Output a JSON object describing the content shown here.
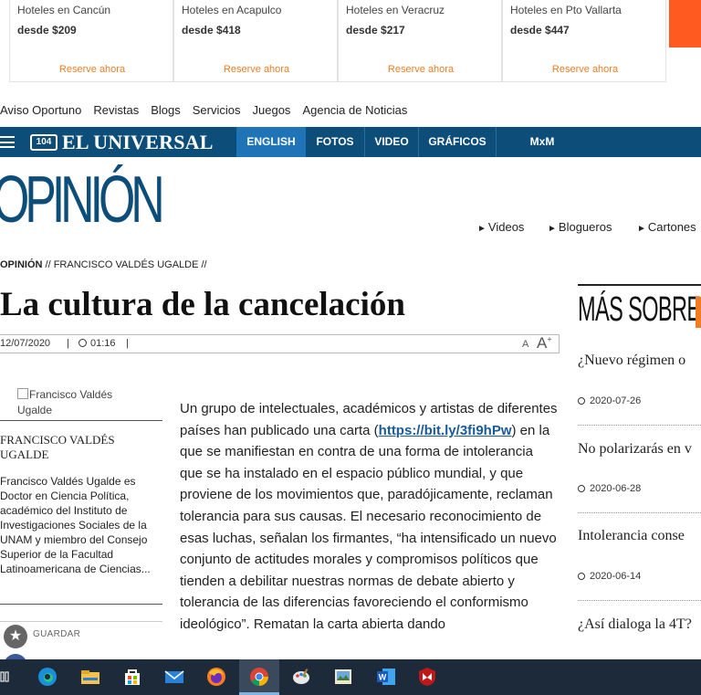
{
  "hotels": [
    {
      "name": "Hoteles en Cancún",
      "price": "desde $209",
      "cta": "Reserve ahora"
    },
    {
      "name": "Hoteles en Acapulco",
      "price": "desde $418",
      "cta": "Reserve ahora"
    },
    {
      "name": "Hoteles en Veracruz",
      "price": "desde $217",
      "cta": "Reserve ahora"
    },
    {
      "name": "Hoteles en Pto Vallarta",
      "price": "desde $447",
      "cta": "Reserve ahora"
    }
  ],
  "topnav": [
    "Aviso Oportuno",
    "Revistas",
    "Blogs",
    "Servicios",
    "Juegos",
    "Agencia de Noticias"
  ],
  "header": {
    "logo_glyph": "104",
    "logo": "EL UNIVERSAL",
    "items": [
      "ENGLISH",
      "FOTOS",
      "VIDEO",
      "GRÁFICOS",
      "MxM"
    ],
    "accent": "#0c4d7a",
    "active_color": "#1f74b7"
  },
  "section": {
    "title": "OPINIÓN",
    "links": [
      "Videos",
      "Blogueros",
      "Cartones"
    ]
  },
  "breadcrumb": {
    "section": "OPINIÓN",
    "sep": "//",
    "author": "FRANCISCO VALDÉS UGALDE"
  },
  "article": {
    "title": "La cultura de la cancelación",
    "date": "12/07/2020",
    "time": "01:16",
    "font_small": "A",
    "font_large": "A",
    "body_before": "Un grupo de intelectuales, académicos y artistas de diferentes países han publicado una carta (",
    "link": "https://bit.ly/3fi9hPw",
    "body_after": ") en la que se manifiestan en contra de una forma de intolerancia que se ha instalado en el espacio público mundial, y que proviene de los movimientos que, paradójicamente, reclaman tolerancia para sus causas. El necesario reconocimiento de esas luchas, señalan los firmantes, “ha intensificado un nuevo conjunto de actitudes morales y compromisos políticos que tienden a debilitar nuestras normas de debate abierto y tolerancia de las diferencias favoreciendo el conformismo ideológico”. Rematan la carta abierta dando"
  },
  "author": {
    "photo_alt": "Francisco Valdés Ugalde",
    "name": "FRANCISCO VALDÉS UGALDE",
    "bio": "Francisco Valdés Ugalde es Doctor en Ciencia Política, académico del Instituto de Investigaciones Sociales de la UNAM y miembro del Consejo Superior de la Facultad Latinoamericana de Ciencias...",
    "save_label": "GUARDAR",
    "save_icon": "★"
  },
  "more": {
    "title": "MÁS SOBRE E",
    "items": [
      {
        "title": "¿Nuevo régimen o",
        "date": "2020-07-26"
      },
      {
        "title": "No polarizarás en v",
        "date": "2020-06-28"
      },
      {
        "title": "Intolerancia conse",
        "date": "2020-06-14"
      },
      {
        "title": "¿Así dialoga la 4T?",
        "date": ""
      }
    ]
  },
  "taskbar": {
    "icons": [
      "task-view-icon",
      "edge-icon",
      "file-explorer-icon",
      "store-icon",
      "mail-icon",
      "firefox-icon",
      "chrome-icon",
      "paint-icon",
      "viewer-icon",
      "word-icon",
      "mcafee-icon"
    ]
  }
}
